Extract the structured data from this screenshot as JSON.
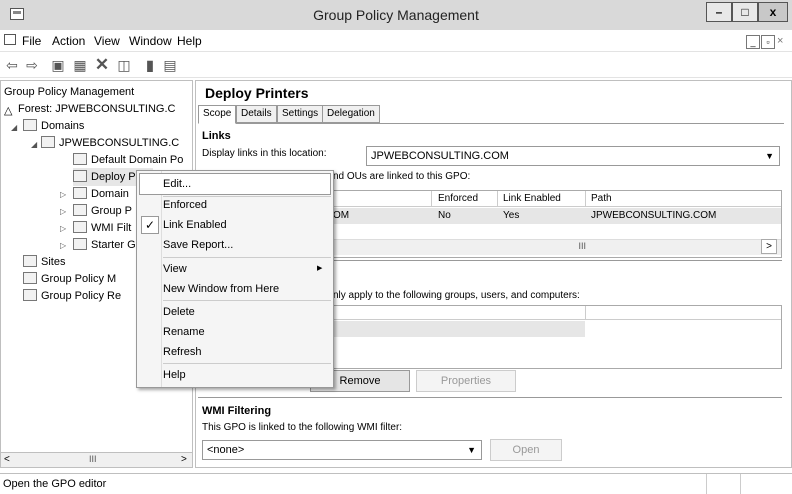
{
  "window": {
    "title": "Group Policy Management",
    "minimize": "–",
    "maximize": "□",
    "close": "x"
  },
  "menu": {
    "items": [
      "File",
      "Action",
      "View",
      "Window",
      "Help"
    ]
  },
  "tree": {
    "root": "Group Policy Management",
    "forest": "Forest: JPWEBCONSULTING.C",
    "domains": "Domains",
    "domain": "JPWEBCONSULTING.C",
    "items": [
      "Default Domain Po",
      "Deploy P",
      "Domain",
      "Group P",
      "WMI Filt",
      "Starter G"
    ],
    "sites": "Sites",
    "gpm": "Group Policy M",
    "gpr": "Group Policy Re",
    "scroll_mid": "III"
  },
  "details": {
    "title": "Deploy Printers",
    "tabs": [
      "Scope",
      "Details",
      "Settings",
      "Delegation"
    ],
    "links_header": "Links",
    "display_links_label": "Display links in this location:",
    "location_value": "JPWEBCONSULTING.COM",
    "linked_text": "nd OUs are linked to this GPO:",
    "columns": [
      "Enforced",
      "Link Enabled",
      "Path"
    ],
    "row": {
      "loc": "OM",
      "enforced": "No",
      "link_enabled": "Yes",
      "path": "JPWEBCONSULTING.COM"
    },
    "scroll_mid": "III",
    "security_text": "nly apply to the following groups, users, and computers:",
    "remove_button": "Remove",
    "properties_button": "Properties",
    "wmi_header": "WMI Filtering",
    "wmi_text": "This GPO is linked to the following WMI filter:",
    "wmi_value": "<none>",
    "open_button": "Open"
  },
  "context_menu": {
    "edit": "Edit...",
    "enforced": "Enforced",
    "link_enabled": "Link Enabled",
    "save_report": "Save Report...",
    "view": "View",
    "new_window": "New Window from Here",
    "delete": "Delete",
    "rename": "Rename",
    "refresh": "Refresh",
    "help": "Help",
    "check": "✓",
    "arrow": "▶"
  },
  "status": {
    "text": "Open the GPO editor"
  }
}
